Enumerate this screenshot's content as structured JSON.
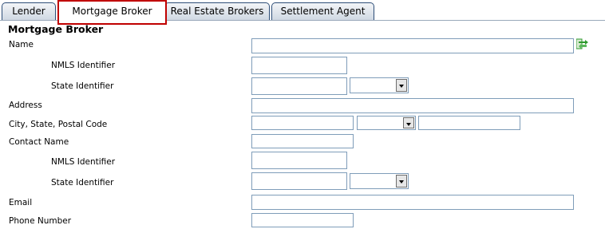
{
  "tabs": [
    {
      "label": "Lender"
    },
    {
      "label": "Mortgage Broker"
    },
    {
      "label": "Real Estate Brokers"
    },
    {
      "label": "Settlement Agent"
    }
  ],
  "active_tab": "Mortgage Broker",
  "section_title": "Mortgage Broker",
  "fields": {
    "name": {
      "label": "Name",
      "value": ""
    },
    "nmls1": {
      "label": "NMLS Identifier",
      "value": ""
    },
    "state1": {
      "label": "State Identifier",
      "value": "",
      "state": ""
    },
    "address": {
      "label": "Address",
      "value": ""
    },
    "city_state_zip": {
      "label": "City, State, Postal Code",
      "city": "",
      "state": "",
      "postal": ""
    },
    "contact": {
      "label": "Contact Name",
      "value": ""
    },
    "nmls2": {
      "label": "NMLS Identifier",
      "value": ""
    },
    "state2": {
      "label": "State Identifier",
      "value": "",
      "state": ""
    },
    "email": {
      "label": "Email",
      "value": ""
    },
    "phone": {
      "label": "Phone Number",
      "value": ""
    }
  },
  "icons": {
    "sync": "copy-arrows-icon"
  },
  "colors": {
    "active_tab_border": "#c00000",
    "tab_border": "#2e4e78",
    "input_border": "#7f9db9",
    "icon_green": "#2e9a2e"
  }
}
